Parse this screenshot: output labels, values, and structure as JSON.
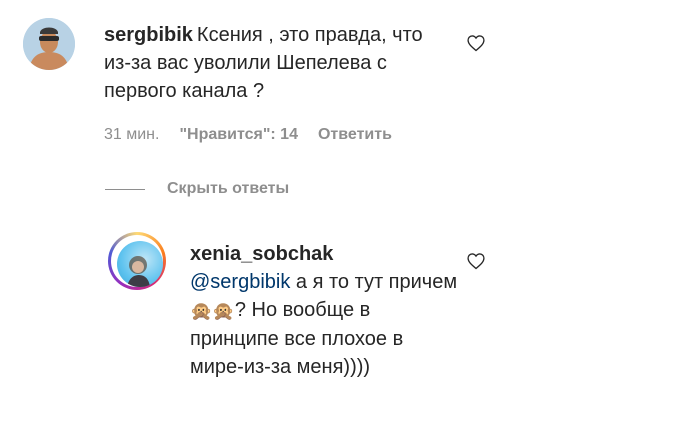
{
  "comment": {
    "username": "sergbibik",
    "text": "Ксения , это правда, что из-за вас уволили Шепелева с первого канала ?",
    "time": "31 мин.",
    "likes": "\"Нравится\": 14",
    "reply_label": "Ответить"
  },
  "replies_toggle": {
    "label": "Скрыть ответы"
  },
  "reply": {
    "username": "xenia_sobchak",
    "mention": "@sergbibik",
    "text_before": " а я то тут причем",
    "emoji": "🙊",
    "text_after": "? Но вообще в принципе все плохое в мире-из-за меня))))"
  },
  "icons": {
    "like": "heart-icon"
  }
}
